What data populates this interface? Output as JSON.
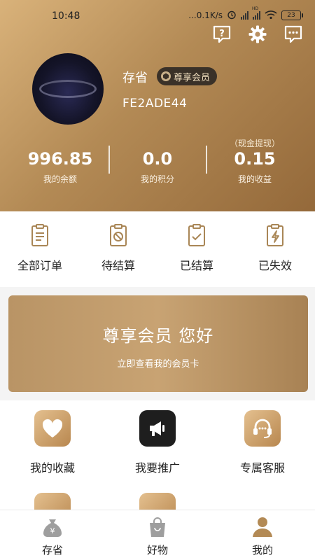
{
  "status_bar": {
    "time": "10:48",
    "net_speed": "...0.1K/s",
    "net_badge": "HD",
    "battery": "23"
  },
  "header_icons": [
    "help-icon",
    "settings-icon",
    "message-icon"
  ],
  "profile": {
    "name": "存省",
    "vip_label": "尊享会员",
    "user_id": "FE2ADE44"
  },
  "stats": [
    {
      "value": "996.85",
      "label": "我的余额",
      "note": ""
    },
    {
      "value": "0.0",
      "label": "我的积分",
      "note": ""
    },
    {
      "value": "0.15",
      "label": "我的收益",
      "note": "（现金提现）"
    }
  ],
  "orders": [
    {
      "label": "全部订单",
      "icon": "all-orders-icon"
    },
    {
      "label": "待结算",
      "icon": "pending-icon"
    },
    {
      "label": "已结算",
      "icon": "settled-icon"
    },
    {
      "label": "已失效",
      "icon": "invalid-icon"
    }
  ],
  "member_card": {
    "title": "尊享会员 您好",
    "subtitle": "立即查看我的会员卡"
  },
  "services": [
    {
      "label": "我的收藏",
      "icon": "heart-icon"
    },
    {
      "label": "我要推广",
      "icon": "megaphone-icon"
    },
    {
      "label": "专属客服",
      "icon": "headset-icon"
    }
  ],
  "bottom_nav": [
    {
      "label": "存省",
      "icon": "money-bag-icon"
    },
    {
      "label": "好物",
      "icon": "shopping-bag-icon"
    },
    {
      "label": "我的",
      "icon": "person-icon"
    }
  ],
  "colors": {
    "brand_gold": "#b38a55",
    "badge_bg": "#3a3128",
    "text_dark": "#222222"
  }
}
